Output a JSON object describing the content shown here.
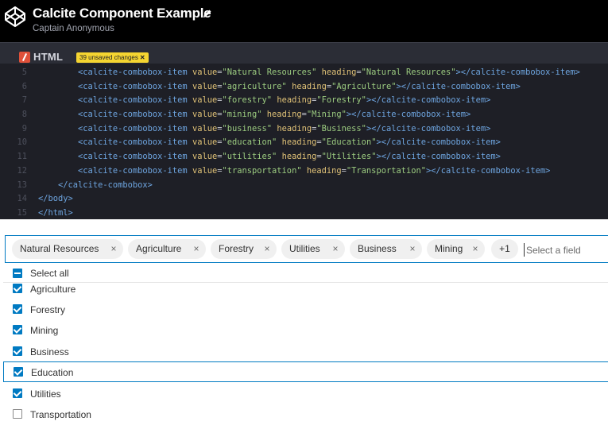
{
  "header": {
    "title": "Calcite Component Example",
    "author": "Captain Anonymous"
  },
  "editor": {
    "language": "HTML",
    "unsaved_badge": "39 unsaved changes",
    "lines": [
      {
        "n": "5",
        "indent": "        ",
        "type": "item",
        "value": "Natural Resources",
        "heading": "Natural Resources"
      },
      {
        "n": "6",
        "indent": "        ",
        "type": "item",
        "value": "agriculture",
        "heading": "Agriculture"
      },
      {
        "n": "7",
        "indent": "        ",
        "type": "item",
        "value": "forestry",
        "heading": "Forestry"
      },
      {
        "n": "8",
        "indent": "        ",
        "type": "item",
        "value": "mining",
        "heading": "Mining"
      },
      {
        "n": "9",
        "indent": "        ",
        "type": "item",
        "value": "business",
        "heading": "Business"
      },
      {
        "n": "10",
        "indent": "        ",
        "type": "item",
        "value": "education",
        "heading": "Education"
      },
      {
        "n": "11",
        "indent": "        ",
        "type": "item",
        "value": "utilities",
        "heading": "Utilities"
      },
      {
        "n": "12",
        "indent": "        ",
        "type": "item",
        "value": "transportation",
        "heading": "Transportation"
      },
      {
        "n": "13",
        "indent": "    ",
        "type": "tag",
        "text": "</calcite-combobox>"
      },
      {
        "n": "14",
        "indent": "",
        "type": "tag",
        "text": "</body>"
      },
      {
        "n": "15",
        "indent": "",
        "type": "tag",
        "text": "</html>"
      }
    ]
  },
  "combobox": {
    "chips": [
      {
        "label": "Natural Resources"
      },
      {
        "label": "Agriculture"
      },
      {
        "label": "Forestry"
      },
      {
        "label": "Utilities"
      },
      {
        "label": "Business"
      },
      {
        "label": "Mining"
      }
    ],
    "overflow_label": "+1",
    "placeholder": "Select a field",
    "chip_close_glyph": "×"
  },
  "dropdown": {
    "select_all_label": "Select all",
    "items": [
      {
        "label": "Agriculture",
        "checked": true
      },
      {
        "label": "Forestry",
        "checked": true
      },
      {
        "label": "Mining",
        "checked": true
      },
      {
        "label": "Business",
        "checked": true
      },
      {
        "label": "Education",
        "checked": true,
        "active": true
      },
      {
        "label": "Utilities",
        "checked": true
      },
      {
        "label": "Transportation",
        "checked": false
      }
    ]
  },
  "colors": {
    "accent": "#007ac2",
    "badge": "#f5d531",
    "html_icon": "#e0513a"
  }
}
